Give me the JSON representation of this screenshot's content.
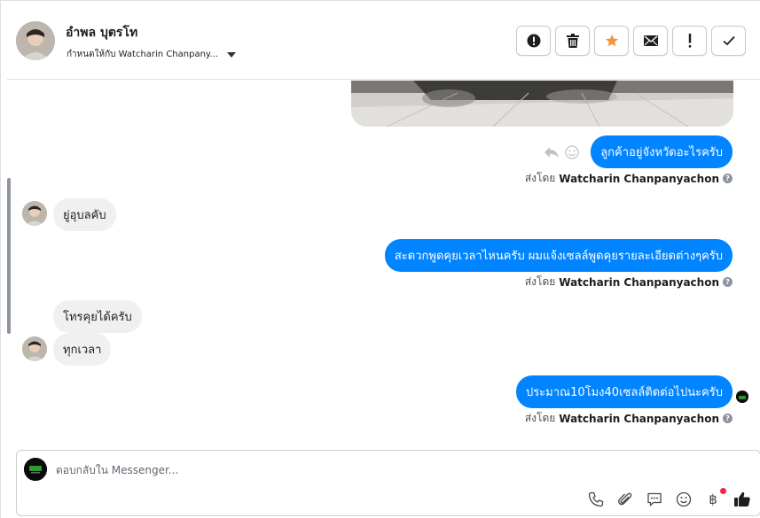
{
  "header": {
    "contact_name": "อำพล บุตรโท",
    "assigned_label": "กำหนดให้กับ Watcharin Chanpany...",
    "actions": [
      {
        "name": "report-spam-button",
        "icon": "alert-circle-icon"
      },
      {
        "name": "delete-button",
        "icon": "trash-icon"
      },
      {
        "name": "star-button",
        "icon": "star-icon"
      },
      {
        "name": "mark-unread-button",
        "icon": "envelope-icon"
      },
      {
        "name": "follow-up-button",
        "icon": "exclamation-icon"
      },
      {
        "name": "mark-done-button",
        "icon": "check-icon"
      }
    ]
  },
  "messages": {
    "m1": "ลูกค้าอยู่จังหวัดอะไรครับ",
    "m2": "ยู่อุบลคับ",
    "m3": "สะดวกพูดคุยเวลาไหนครับ ผมแจ้งเซลล์พูดคุยรายละเอียดต่างๆครับ",
    "m4": "โทรคุยได้ครับ",
    "m5": "ทุกเวลา",
    "m6": "ประมาณ10โมง40เซลล์ติดต่อไปนะครับ"
  },
  "sent_by": {
    "prefix": "ส่งโดย",
    "agent": "Watcharin Chanpanyachon"
  },
  "composer": {
    "placeholder": "ตอบกลับใน Messenger...",
    "value": "",
    "tools": [
      "phone-icon",
      "paperclip-icon",
      "saved-replies-icon",
      "emoji-icon",
      "baht-icon",
      "thumbs-up-icon"
    ],
    "baht_symbol": "฿"
  },
  "colors": {
    "accent": "#0084ff",
    "incoming_bubble": "#f0f0f0",
    "star": "#f7923b",
    "notification": "#f02849"
  }
}
